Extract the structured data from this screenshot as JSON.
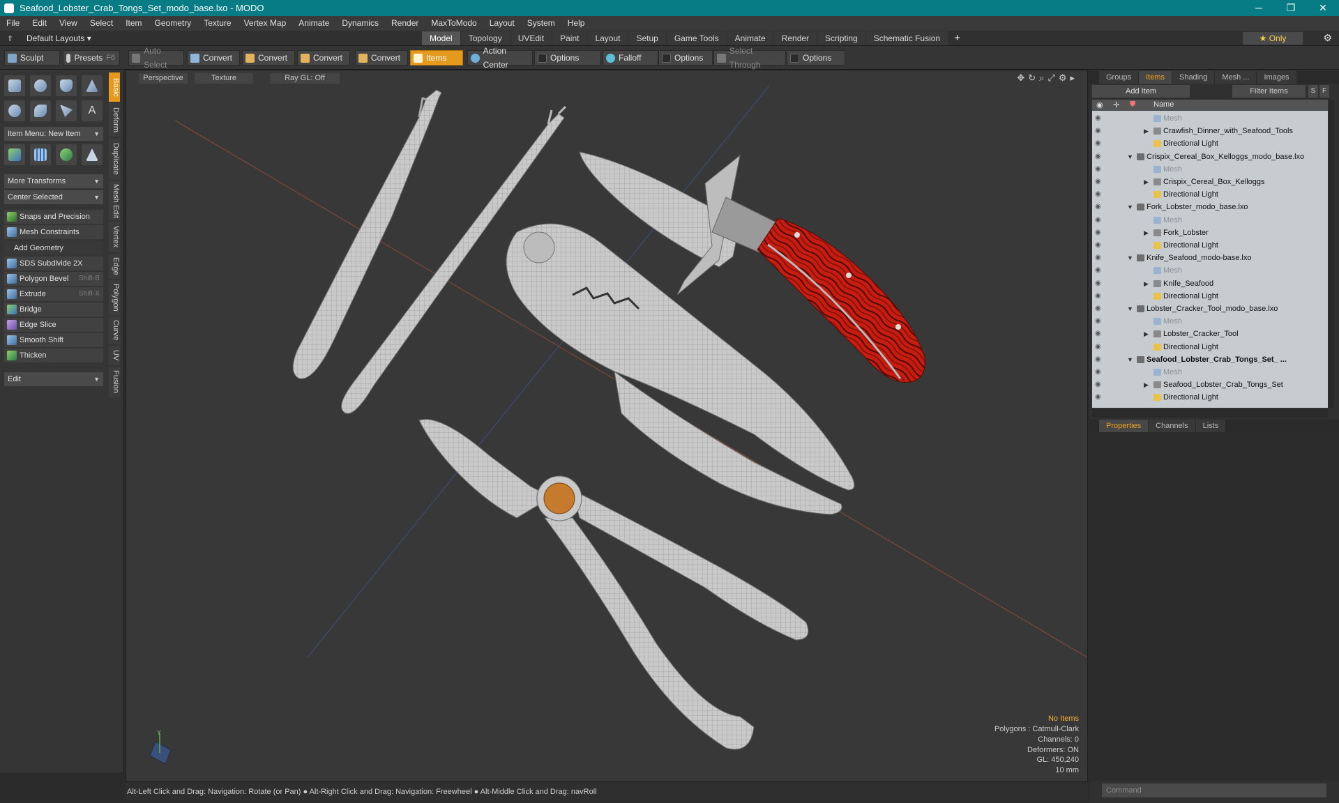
{
  "window": {
    "title": "Seafood_Lobster_Crab_Tongs_Set_modo_base.lxo - MODO",
    "minimize": "─",
    "maximize": "❐",
    "close": "✕"
  },
  "menu": [
    "File",
    "Edit",
    "View",
    "Select",
    "Item",
    "Geometry",
    "Texture",
    "Vertex Map",
    "Animate",
    "Dynamics",
    "Render",
    "MaxToModo",
    "Layout",
    "System",
    "Help"
  ],
  "layoutbar": {
    "default_layouts": "Default Layouts ▾",
    "tabs": [
      "Model",
      "Topology",
      "UVEdit",
      "Paint",
      "Layout",
      "Setup",
      "Game Tools",
      "Animate",
      "Render",
      "Scripting",
      "Schematic Fusion"
    ],
    "active_tab": "Model",
    "add": "+",
    "only": "★  Only"
  },
  "toolbar": {
    "sculpt": "Sculpt",
    "presets": "Presets",
    "presets_key": "F6",
    "auto_select": "Auto Select",
    "convert": "Convert",
    "items": "Items",
    "action_center": "Action Center",
    "options": "Options",
    "falloff": "Falloff",
    "select_through": "Select Through"
  },
  "left": {
    "item_menu": "Item Menu: New Item",
    "more_transforms": "More Transforms",
    "center_selected": "Center Selected",
    "snaps": "Snaps and Precision",
    "mesh_constraints": "Mesh Constraints",
    "add_geometry": "Add Geometry",
    "tools": [
      {
        "label": "SDS Subdivide 2X",
        "shortcut": ""
      },
      {
        "label": "Polygon Bevel",
        "shortcut": "Shift-B"
      },
      {
        "label": "Extrude",
        "shortcut": "Shift-X"
      },
      {
        "label": "Bridge",
        "shortcut": ""
      },
      {
        "label": "Edge Slice",
        "shortcut": ""
      },
      {
        "label": "Smooth Shift",
        "shortcut": ""
      },
      {
        "label": "Thicken",
        "shortcut": ""
      }
    ],
    "edit": "Edit",
    "vtabs": [
      "Basic",
      "Deform",
      "Duplicate",
      "Mesh Edit",
      "Vertex",
      "Edge",
      "Polygon",
      "Curve",
      "UV",
      "Fusion"
    ]
  },
  "viewport": {
    "view": "Perspective",
    "shading": "Texture",
    "raygl": "Ray GL: Off",
    "info": {
      "items": "No Items",
      "polygons": "Polygons : Catmull-Clark",
      "channels": "Channels: 0",
      "deformers": "Deformers: ON",
      "gl": "GL: 450,240",
      "scale": "10 mm"
    },
    "axis_y": "Y"
  },
  "status": "Alt-Left Click and Drag: Navigation: Rotate (or Pan) ● Alt-Right Click and Drag: Navigation: Freewheel ● Alt-Middle Click and Drag: navRoll",
  "right": {
    "tabs": [
      "Groups",
      "Items",
      "Shading",
      "Mesh ...",
      "Images"
    ],
    "active_tab": "Items",
    "add_item": "Add Item",
    "filter": "Filter Items",
    "s": "S",
    "f": "F",
    "name_col": "Name",
    "tree": [
      {
        "label": "Mesh",
        "kind": "mesh",
        "indent": 2
      },
      {
        "label": "Crawfish_Dinner_with_Seafood_Tools",
        "kind": "item",
        "indent": 2
      },
      {
        "label": "Directional Light",
        "kind": "light",
        "indent": 2
      },
      {
        "label": "Crispix_Cereal_Box_Kelloggs_modo_base.lxo",
        "kind": "scene",
        "indent": 1
      },
      {
        "label": "Mesh",
        "kind": "mesh",
        "indent": 2
      },
      {
        "label": "Crispix_Cereal_Box_Kelloggs",
        "kind": "item",
        "indent": 2
      },
      {
        "label": "Directional Light",
        "kind": "light",
        "indent": 2
      },
      {
        "label": "Fork_Lobster_modo_base.lxo",
        "kind": "scene",
        "indent": 1
      },
      {
        "label": "Mesh",
        "kind": "mesh",
        "indent": 2
      },
      {
        "label": "Fork_Lobster",
        "kind": "item",
        "indent": 2
      },
      {
        "label": "Directional Light",
        "kind": "light",
        "indent": 2
      },
      {
        "label": "Knife_Seafood_modo-base.lxo",
        "kind": "scene",
        "indent": 1
      },
      {
        "label": "Mesh",
        "kind": "mesh",
        "indent": 2
      },
      {
        "label": "Knife_Seafood",
        "kind": "item",
        "indent": 2
      },
      {
        "label": "Directional Light",
        "kind": "light",
        "indent": 2
      },
      {
        "label": "Lobster_Cracker_Tool_modo_base.lxo",
        "kind": "scene",
        "indent": 1
      },
      {
        "label": "Mesh",
        "kind": "mesh",
        "indent": 2
      },
      {
        "label": "Lobster_Cracker_Tool",
        "kind": "item",
        "indent": 2
      },
      {
        "label": "Directional Light",
        "kind": "light",
        "indent": 2
      },
      {
        "label": "Seafood_Lobster_Crab_Tongs_Set_ ...",
        "kind": "scene",
        "indent": 1,
        "bold": true
      },
      {
        "label": "Mesh",
        "kind": "mesh",
        "indent": 2
      },
      {
        "label": "Seafood_Lobster_Crab_Tongs_Set",
        "kind": "item",
        "indent": 2
      },
      {
        "label": "Directional Light",
        "kind": "light",
        "indent": 2
      }
    ],
    "ptabs": [
      "Properties",
      "Channels",
      "Lists"
    ],
    "active_ptab": "Properties",
    "command": "Command"
  },
  "colors": {
    "accent": "#e59a1d",
    "titlebar": "#087c85",
    "handle_red": "#c21c0f"
  }
}
